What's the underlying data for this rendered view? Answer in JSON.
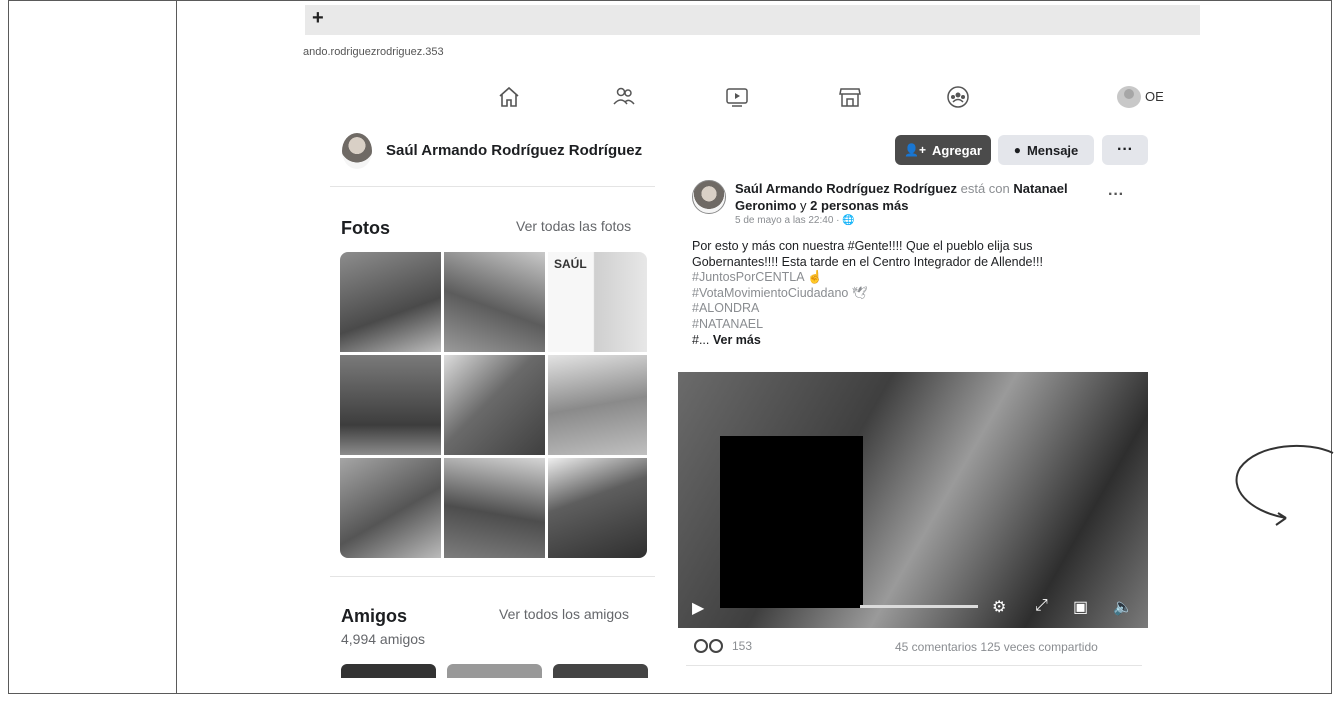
{
  "browser": {
    "new_tab_symbol": "+",
    "url": "ando.rodriguezrodriguez.353"
  },
  "top_nav": {
    "icons": [
      "home-icon",
      "friends-icon",
      "watch-icon",
      "marketplace-icon",
      "groups-icon"
    ],
    "user_initials": "OE"
  },
  "profile": {
    "name": "Saúl Armando Rodríguez Rodríguez",
    "buttons": {
      "add": "Agregar",
      "message": "Mensaje",
      "more": "···"
    }
  },
  "photos": {
    "title": "Fotos",
    "see_all": "Ver todas las fotos",
    "poster_text": "SAÚL"
  },
  "friends": {
    "title": "Amigos",
    "see_all": "Ver todos los amigos",
    "count": "4,994 amigos"
  },
  "post": {
    "author": "Saúl Armando Rodríguez Rodríguez",
    "with_text": "está con",
    "tagged": "Natanael Geronimo",
    "and_text": "y",
    "others": "2 personas más",
    "timestamp": "5 de mayo a las 22:40 · ",
    "more": "···",
    "lines": [
      "Por esto y más con nuestra #Gente!!!! Que el pueblo elija sus",
      "Gobernantes!!!!  Esta tarde en el Centro Integrador de Allende!!!",
      "#JuntosPorCENTLA ☝",
      "#VotaMovimientoCiudadano 🕊",
      "#ALONDRA",
      "#NATANAEL"
    ],
    "truncated_prefix": "#...",
    "see_more": "Ver más",
    "reaction_count": "153",
    "comments": "45 comentarios",
    "shares": "125 veces compartido"
  }
}
